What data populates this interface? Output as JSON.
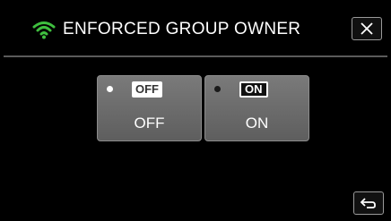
{
  "header": {
    "title": "ENFORCED GROUP OWNER",
    "icon": "wifi-icon"
  },
  "options": [
    {
      "badge": "OFF",
      "label": "OFF",
      "selected": true
    },
    {
      "badge": "ON",
      "label": "ON",
      "selected": false
    }
  ],
  "controls": {
    "close_icon": "close-icon",
    "back_icon": "return-icon"
  },
  "colors": {
    "accent": "#3fbf3f",
    "background": "#000000",
    "button": "#6e6e6e"
  }
}
